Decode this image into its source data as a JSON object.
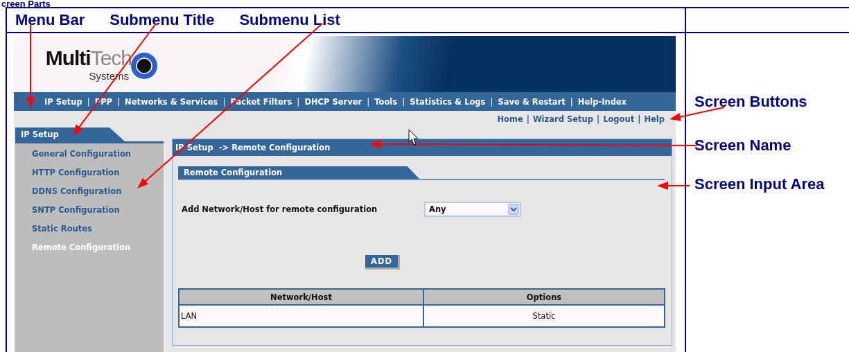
{
  "page_heading": "creen Parts",
  "callouts_top": [
    "Menu Bar",
    "Submenu Title",
    "Submenu List"
  ],
  "callouts_right": [
    "Screen Buttons",
    "Screen Name",
    "Screen Input Area"
  ],
  "logo": {
    "bold": "Multi",
    "light": "Tech",
    "sub": "Systems"
  },
  "menu_bar": {
    "separator": "|",
    "items": [
      "IP Setup",
      "PPP",
      "Networks & Services",
      "Packet Filters",
      "DHCP Server",
      "Tools",
      "Statistics & Logs",
      "Save & Restart",
      "Help-Index"
    ]
  },
  "screen_buttons": {
    "separator": "|",
    "items": [
      "Home",
      "Wizard Setup",
      "Logout",
      "Help"
    ]
  },
  "submenu": {
    "title": "IP Setup",
    "items": [
      {
        "label": "General Configuration",
        "selected": false
      },
      {
        "label": "HTTP Configuration",
        "selected": false
      },
      {
        "label": "DDNS Configuration",
        "selected": false
      },
      {
        "label": "SNTP Configuration",
        "selected": false
      },
      {
        "label": "Static Routes",
        "selected": false
      },
      {
        "label": "Remote Configuration",
        "selected": true
      }
    ]
  },
  "screen_name": "IP Setup  -> Remote Configuration",
  "section_title": "Remote Configuration",
  "field": {
    "label": "Add Network/Host for remote configuration",
    "value": "Any"
  },
  "add_button": "ADD",
  "table": {
    "columns": [
      "Network/Host",
      "Options"
    ],
    "rows": [
      [
        "LAN",
        "Static"
      ]
    ]
  }
}
